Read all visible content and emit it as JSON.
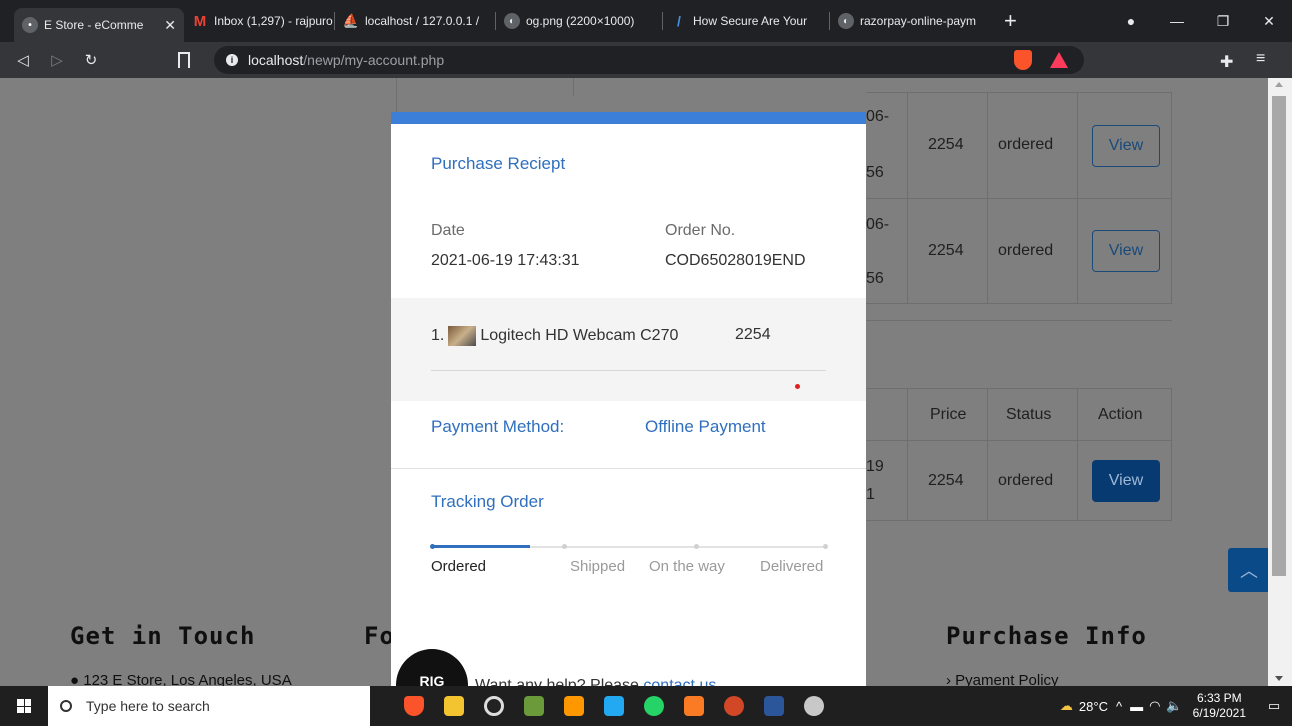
{
  "browser": {
    "tabs": [
      {
        "title": "E Store - eComme",
        "active": true
      },
      {
        "title": "Inbox (1,297) - rajpuro"
      },
      {
        "title": "localhost / 127.0.0.1 /"
      },
      {
        "title": "og.png (2200×1000)"
      },
      {
        "title": "How Secure Are Your"
      },
      {
        "title": "razorpay-online-paym"
      }
    ],
    "url_host": "localhost",
    "url_path": "/newp/my-account.php"
  },
  "background": {
    "orders": [
      {
        "date_a": "06-",
        "date_b": "56",
        "price": "2254",
        "status": "ordered",
        "action": "View"
      },
      {
        "date_a": "06-",
        "date_b": "56",
        "price": "2254",
        "status": "ordered",
        "action": "View"
      },
      {
        "date_a": "19",
        "date_b": "1",
        "price": "2254",
        "status": "ordered",
        "action": "View"
      }
    ],
    "headers": {
      "price": "Price",
      "status": "Status",
      "action": "Action"
    },
    "footer": {
      "get_in_touch": "Get in Touch",
      "partial_heading": "Fo",
      "purchase_info": "Purchase Info",
      "address": "123 E Store, Los Angeles, USA",
      "payment_policy": "Pyament Policy"
    }
  },
  "modal": {
    "title": "Purchase Reciept",
    "date_label": "Date",
    "date_value": "2021-06-19 17:43:31",
    "order_label": "Order No.",
    "order_value": "COD65028019END",
    "item_index": "1.",
    "item_name": "Logitech HD Webcam C270",
    "item_price": "2254",
    "payment_label": "Payment Method:",
    "payment_value": "Offline Payment",
    "tracking_title": "Tracking Order",
    "steps": [
      "Ordered",
      "Shipped",
      "On the way",
      "Delivered"
    ],
    "help_text": "Want any help? Please ",
    "help_link": "contact us",
    "avatar_text": "RIG"
  },
  "taskbar": {
    "search_placeholder": "Type here to search",
    "weather": "28°C",
    "time": "6:33 PM",
    "date": "6/19/2021"
  },
  "colors": {
    "accent": "#3c7fd9",
    "link": "#2f6fbd"
  }
}
